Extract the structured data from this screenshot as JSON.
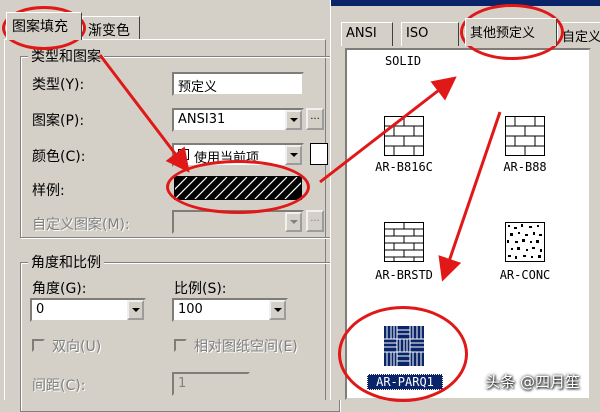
{
  "left_tabs": {
    "hatch": "图案填充",
    "gradient": "渐变色"
  },
  "type_group": {
    "title": "类型和图案",
    "type_label": "类型(Y):",
    "type_value": "预定义",
    "pattern_label": "图案(P):",
    "pattern_value": "ANSI31",
    "pattern_more": "...",
    "color_label": "颜色(C):",
    "color_value": "使用当前项",
    "swatch_label": "样例:",
    "custom_label": "自定义图案(M):",
    "custom_more": "..."
  },
  "angle_group": {
    "title": "角度和比例",
    "angle_label": "角度(G):",
    "angle_value": "0",
    "scale_label": "比例(S):",
    "scale_value": "100",
    "double_label": "双向(U)",
    "relative_label": "相对图纸空间(E)",
    "spacing_label": "间距(C):",
    "spacing_value": "1"
  },
  "right_tabs": [
    "ANSI",
    "ISO",
    "其他预定义",
    "自定义"
  ],
  "patterns": {
    "solid": "SOLID",
    "b816c": "AR-B816C",
    "b88": "AR-B88",
    "brstd": "AR-BRSTD",
    "conc": "AR-CONC",
    "parq1": "AR-PARQ1"
  },
  "watermark": "头条 @四月笙",
  "colors": {
    "annotation": "#e01818",
    "selection": "#0a246a"
  }
}
